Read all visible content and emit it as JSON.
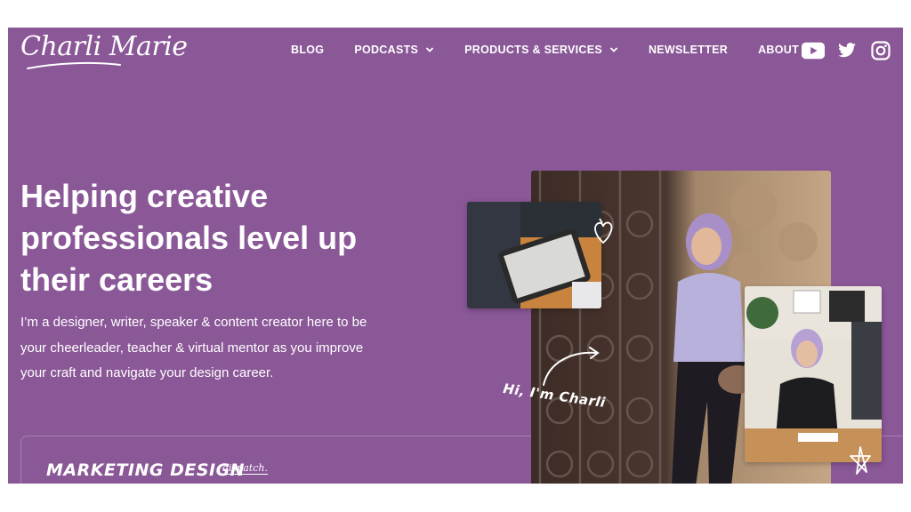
{
  "brand": {
    "logo_text": "Charli Marie"
  },
  "nav": {
    "items": [
      {
        "label": "BLOG",
        "dropdown": false
      },
      {
        "label": "PODCASTS",
        "dropdown": true
      },
      {
        "label": "PRODUCTS & SERVICES",
        "dropdown": true
      },
      {
        "label": "NEWSLETTER",
        "dropdown": false
      },
      {
        "label": "ABOUT",
        "dropdown": false
      }
    ],
    "socials": [
      "youtube-icon",
      "twitter-icon",
      "instagram-icon"
    ]
  },
  "hero": {
    "title": "Helping creative professionals level up their careers",
    "description": "I’m a designer, writer, speaker & content creator here to be your cheerleader, teacher & virtual mentor as you improve your craft and navigate your design career.",
    "greeting": "Hi, I'm Charli"
  },
  "card": {
    "brand": "MARKETING DESIGN",
    "sub": "dispatch."
  },
  "colors": {
    "background": "#8a5797",
    "text": "#ffffff"
  }
}
